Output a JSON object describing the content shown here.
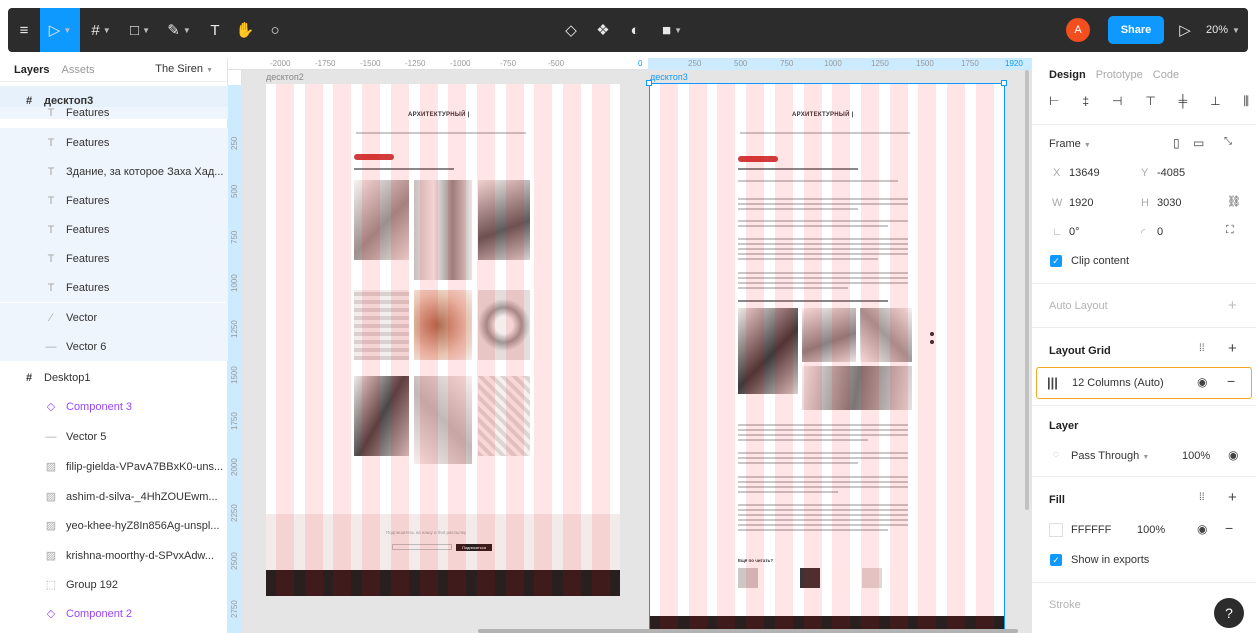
{
  "toolbar": {
    "menu_icon": "≡",
    "move_icon": "▷",
    "frame_icon": "#",
    "shape_icon": "□",
    "pen_icon": "✎",
    "text_icon": "T",
    "hand_icon": "✋",
    "comment_icon": "○",
    "component_icons": [
      "◇",
      "❖",
      "◐",
      "■"
    ],
    "avatar_letter": "A",
    "share_label": "Share",
    "play_icon": "▷",
    "zoom_label": "20%"
  },
  "left_panel": {
    "tabs": [
      "Layers",
      "Assets"
    ],
    "page_name": "The Siren",
    "layers": [
      {
        "icon": "#",
        "label": "десктоп3"
      },
      {
        "icon": "T",
        "label": "Features"
      },
      {
        "icon": "T",
        "label": "Features"
      },
      {
        "icon": "T",
        "label": "Здание, за которое Заха Хад..."
      },
      {
        "icon": "T",
        "label": "Features"
      },
      {
        "icon": "T",
        "label": "Features"
      },
      {
        "icon": "T",
        "label": "Features"
      },
      {
        "icon": "T",
        "label": "Features"
      },
      {
        "icon": "⁄",
        "label": "Vector"
      },
      {
        "icon": "—",
        "label": "Vector 6"
      },
      {
        "icon": "#",
        "label": "Desktop1"
      },
      {
        "icon": "◇",
        "label": "Component 3"
      },
      {
        "icon": "—",
        "label": "Vector 5"
      },
      {
        "icon": "▨",
        "label": "filip-gielda-VPavA7BBxK0-uns..."
      },
      {
        "icon": "▨",
        "label": "ashim-d-silva-_4HhZOUEwm..."
      },
      {
        "icon": "▨",
        "label": "yeo-khee-hyZ8In856Ag-unspl..."
      },
      {
        "icon": "▨",
        "label": "krishna-moorthy-d-SPvxAdw..."
      },
      {
        "icon": "⬚",
        "label": "Group 192"
      },
      {
        "icon": "◇",
        "label": "Component 2"
      }
    ]
  },
  "canvas": {
    "ruler_h": [
      "-2000",
      "-1750",
      "-1500",
      "-1250",
      "-1000",
      "-750",
      "-500",
      "0",
      "250",
      "500",
      "750",
      "1000",
      "1250",
      "1500",
      "1750",
      "1920"
    ],
    "ruler_v": [
      "250",
      "500",
      "750",
      "1000",
      "1250",
      "1500",
      "1750",
      "2000",
      "2250",
      "2500",
      "2750"
    ],
    "frame1_label": "десктоп2",
    "frame2_label": "десктоп3",
    "art_title": "АРХИТЕКТУРНЫЙ |",
    "subscribe_text": "Подпишитесь на нашу и thot рассылку",
    "subscribe_button": "Подписаться",
    "caption1": "Ещё по читать?"
  },
  "right_panel": {
    "tabs": [
      "Design",
      "Prototype",
      "Code"
    ],
    "frame_label": "Frame",
    "x_label": "X",
    "x_value": "13649",
    "y_label": "Y",
    "y_value": "-4085",
    "w_label": "W",
    "w_value": "1920",
    "h_label": "H",
    "h_value": "3030",
    "rotation_value": "0°",
    "radius_value": "0",
    "clip_content": "Clip content",
    "auto_layout": "Auto Layout",
    "layout_grid": "Layout Grid",
    "grid_item": "12 Columns (Auto)",
    "layer": "Layer",
    "blend_mode": "Pass Through",
    "layer_opacity": "100%",
    "fill": "Fill",
    "fill_hex": "FFFFFF",
    "fill_opacity": "100%",
    "show_in_exports": "Show in exports",
    "stroke": "Stroke",
    "help": "?"
  },
  "colors": {
    "accent": "#0d99ff",
    "toolbar_bg": "#2c2c2c",
    "selection_outline": "#f5a623",
    "grid_column": "#ff0000"
  }
}
